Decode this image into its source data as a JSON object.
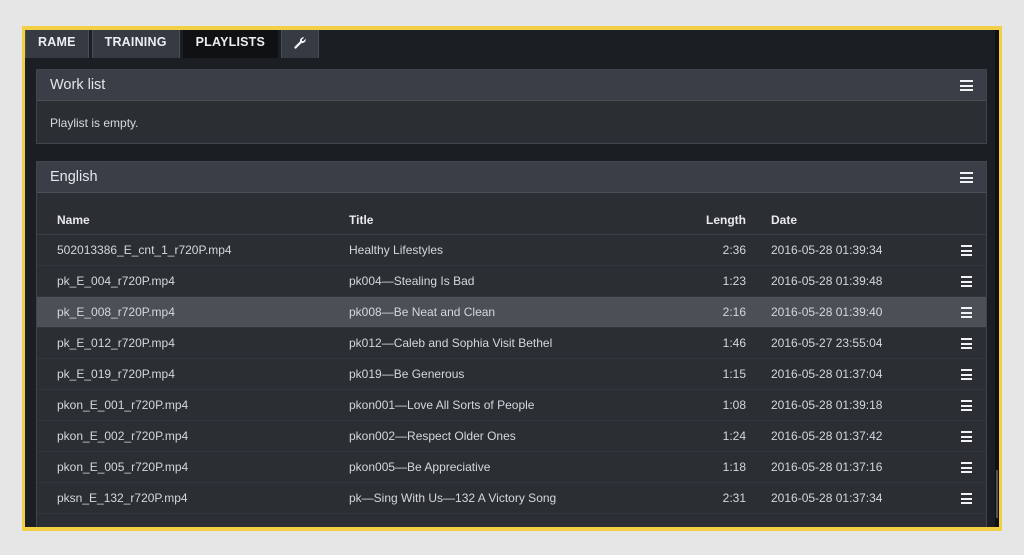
{
  "tabs": [
    {
      "label": "RAME"
    },
    {
      "label": "TRAINING"
    },
    {
      "label": "PLAYLISTS",
      "active": true
    },
    {
      "icon": "wrench-icon"
    }
  ],
  "work_list": {
    "title": "Work list",
    "empty_message": "Playlist is empty."
  },
  "english": {
    "title": "English",
    "columns": {
      "name": "Name",
      "title": "Title",
      "length": "Length",
      "date": "Date"
    },
    "rows": [
      {
        "name": "502013386_E_cnt_1_r720P.mp4",
        "title": "Healthy Lifestyles",
        "length": "2:36",
        "date": "2016-05-28 01:39:34"
      },
      {
        "name": "pk_E_004_r720P.mp4",
        "title": "pk004—Stealing Is Bad",
        "length": "1:23",
        "date": "2016-05-28 01:39:48"
      },
      {
        "name": "pk_E_008_r720P.mp4",
        "title": "pk008—Be Neat and Clean",
        "length": "2:16",
        "date": "2016-05-28 01:39:40",
        "highlighted": true
      },
      {
        "name": "pk_E_012_r720P.mp4",
        "title": "pk012—Caleb and Sophia Visit Bethel",
        "length": "1:46",
        "date": "2016-05-27 23:55:04"
      },
      {
        "name": "pk_E_019_r720P.mp4",
        "title": "pk019—Be Generous",
        "length": "1:15",
        "date": "2016-05-28 01:37:04"
      },
      {
        "name": "pkon_E_001_r720P.mp4",
        "title": "pkon001—Love All Sorts of People",
        "length": "1:08",
        "date": "2016-05-28 01:39:18"
      },
      {
        "name": "pkon_E_002_r720P.mp4",
        "title": "pkon002—Respect Older Ones",
        "length": "1:24",
        "date": "2016-05-28 01:37:42"
      },
      {
        "name": "pkon_E_005_r720P.mp4",
        "title": "pkon005—Be Appreciative",
        "length": "1:18",
        "date": "2016-05-28 01:37:16"
      },
      {
        "name": "pksn_E_132_r720P.mp4",
        "title": "pk—Sing With Us—132 A Victory Song",
        "length": "2:31",
        "date": "2016-05-28 01:37:34"
      }
    ]
  },
  "colors": {
    "accent_border": "#f2cf45",
    "background": "#1b1e22",
    "panel": "#2b2f34",
    "highlight_row": "#4b5056"
  }
}
